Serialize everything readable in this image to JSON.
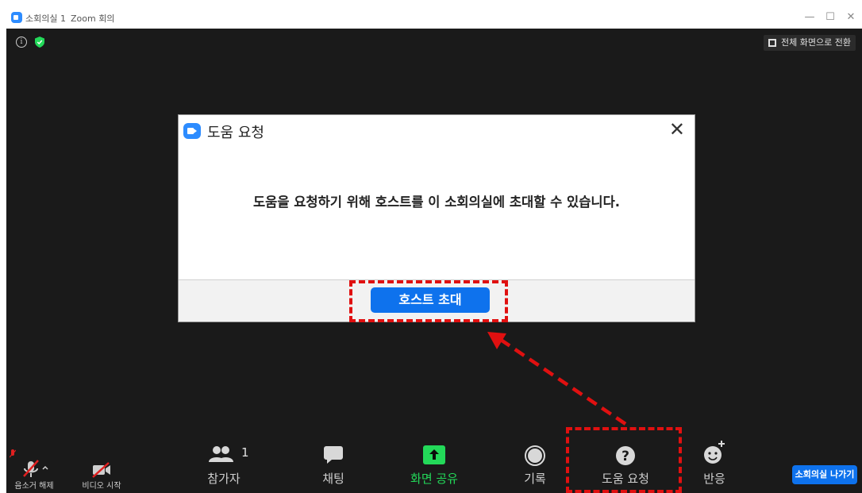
{
  "window": {
    "title": "소회의실 1",
    "subtitle": "Zoom 회의",
    "controls": {
      "minimize": "—",
      "maximize": "☐",
      "close": "✕"
    }
  },
  "top": {
    "info_icon": "info-icon",
    "shield_icon": "shield-icon",
    "fullscreen_label": "전체 화면으로 전환"
  },
  "dialog": {
    "title": "도움 요청",
    "close_glyph": "✕",
    "message": "도움을 요청하기 위해 호스트를 이 소회의실에 초대할 수 있습니다.",
    "invite_button": "호스트 초대"
  },
  "toolbar": {
    "mute": {
      "label": "음소거 해제",
      "icon": "mic-off-icon"
    },
    "video": {
      "label": "비디오 시작",
      "icon": "video-off-icon"
    },
    "participants": {
      "label": "참가자",
      "count": "1",
      "icon": "participants-icon"
    },
    "chat": {
      "label": "채팅",
      "icon": "chat-icon"
    },
    "share": {
      "label": "화면 공유",
      "icon": "share-screen-icon"
    },
    "record": {
      "label": "기록",
      "icon": "record-icon"
    },
    "help": {
      "label": "도움 요청",
      "icon": "question-icon"
    },
    "reactions": {
      "label": "반응",
      "icon": "reaction-icon"
    },
    "leave_breakout": "소회의실 나가기"
  },
  "colors": {
    "zoom_blue": "#0e72ed",
    "share_green": "#23d959",
    "annotation_red": "#e01010",
    "meeting_bg": "#1a1a1a"
  }
}
